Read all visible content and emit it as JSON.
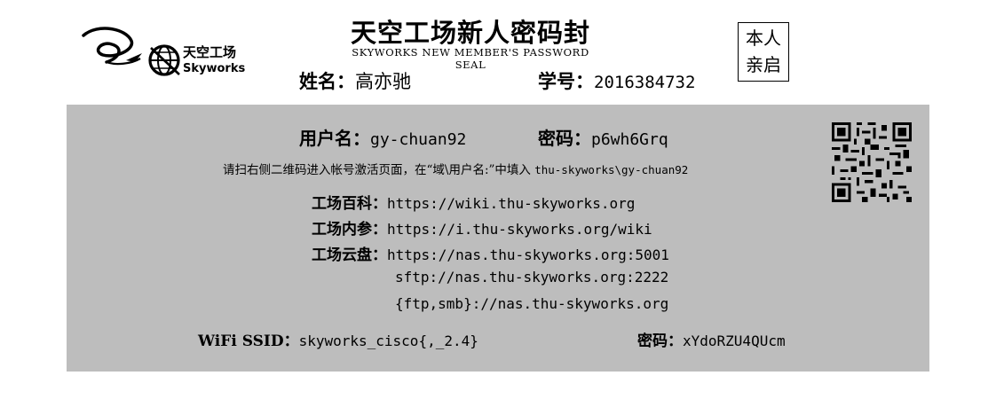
{
  "header": {
    "logo": {
      "cn": "天空工场",
      "en": "Skyworks"
    },
    "title": "天空工场新人密码封",
    "subtitle": "SKYWORKS NEW MEMBER'S PASSWORD SEAL",
    "personal_label": [
      "本人",
      "亲启"
    ],
    "name_label": "姓名：",
    "name_value": "高亦驰",
    "id_label": "学号：",
    "id_value": "2016384732"
  },
  "credentials": {
    "username_label": "用户名：",
    "username": "gy-chuan92",
    "password_label": "密码：",
    "password": "p6wh6Grq",
    "hint_text": "请扫右侧二维码进入帐号激活页面，在“域\\用户名:”中填入",
    "hint_value": "thu-skyworks\\gy-chuan92"
  },
  "links": [
    {
      "label": "工场百科：",
      "url": "https://wiki.thu-skyworks.org"
    },
    {
      "label": "工场内参：",
      "url": "https://i.thu-skyworks.org/wiki"
    },
    {
      "label": "工场云盘：",
      "url": "https://nas.thu-skyworks.org:5001"
    },
    {
      "label": "",
      "url": "sftp://nas.thu-skyworks.org:2222"
    },
    {
      "label": "",
      "url": "{ftp,smb}://nas.thu-skyworks.org"
    }
  ],
  "wifi": {
    "ssid_label": "WiFi SSID：",
    "ssid": "skyworks_cisco{,_2.4}",
    "password_label": "密码：",
    "password": "xYdoRZU4QUcm"
  },
  "qr_icon": "qr-code-icon"
}
